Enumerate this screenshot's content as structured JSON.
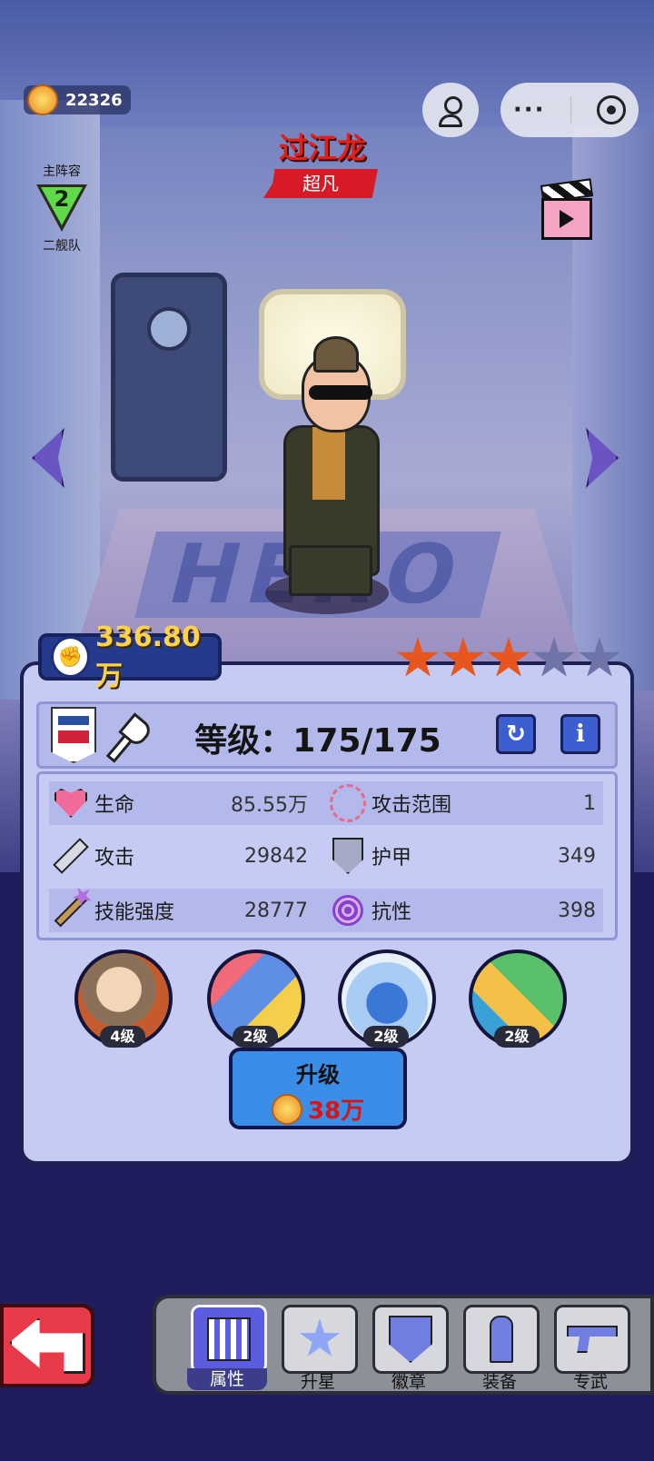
{
  "currency": {
    "amount": "22326",
    "icon": "gold-coin-icon"
  },
  "lineup": {
    "label": "主阵容",
    "number": "2",
    "squad": "二舰队"
  },
  "hero": {
    "name": "过江龙",
    "rank": "超凡",
    "name_color": "#e22018"
  },
  "power": {
    "value": "336.80万"
  },
  "stars": {
    "filled": 3,
    "total": 5
  },
  "level": {
    "text": "等级：175/175",
    "refresh_icon": "refresh-icon",
    "info_label": "i"
  },
  "stats": [
    {
      "label": "生命",
      "value": "85.55万",
      "icon": "heart-icon"
    },
    {
      "label": "攻击范围",
      "value": "1",
      "icon": "range-icon"
    },
    {
      "label": "攻击",
      "value": "29842",
      "icon": "sword-icon"
    },
    {
      "label": "护甲",
      "value": "349",
      "icon": "shield-icon"
    },
    {
      "label": "技能强度",
      "value": "28777",
      "icon": "wand-icon"
    },
    {
      "label": "抗性",
      "value": "398",
      "icon": "resist-icon"
    }
  ],
  "skills": [
    {
      "level": "4级"
    },
    {
      "level": "2级"
    },
    {
      "level": "2级"
    },
    {
      "level": "2级"
    }
  ],
  "upgrade": {
    "label": "升级",
    "cost": "38万"
  },
  "tabs": [
    {
      "label": "属性",
      "active": true
    },
    {
      "label": "升星",
      "active": false
    },
    {
      "label": "徽章",
      "active": false
    },
    {
      "label": "装备",
      "active": false
    },
    {
      "label": "专武",
      "active": false
    }
  ],
  "scene": {
    "mat_text": "HERO"
  },
  "colors": {
    "panel": "#c5cbf2",
    "accent": "#3a8ee8",
    "star_on": "#e8561f",
    "rank_banner": "#d61b26"
  }
}
